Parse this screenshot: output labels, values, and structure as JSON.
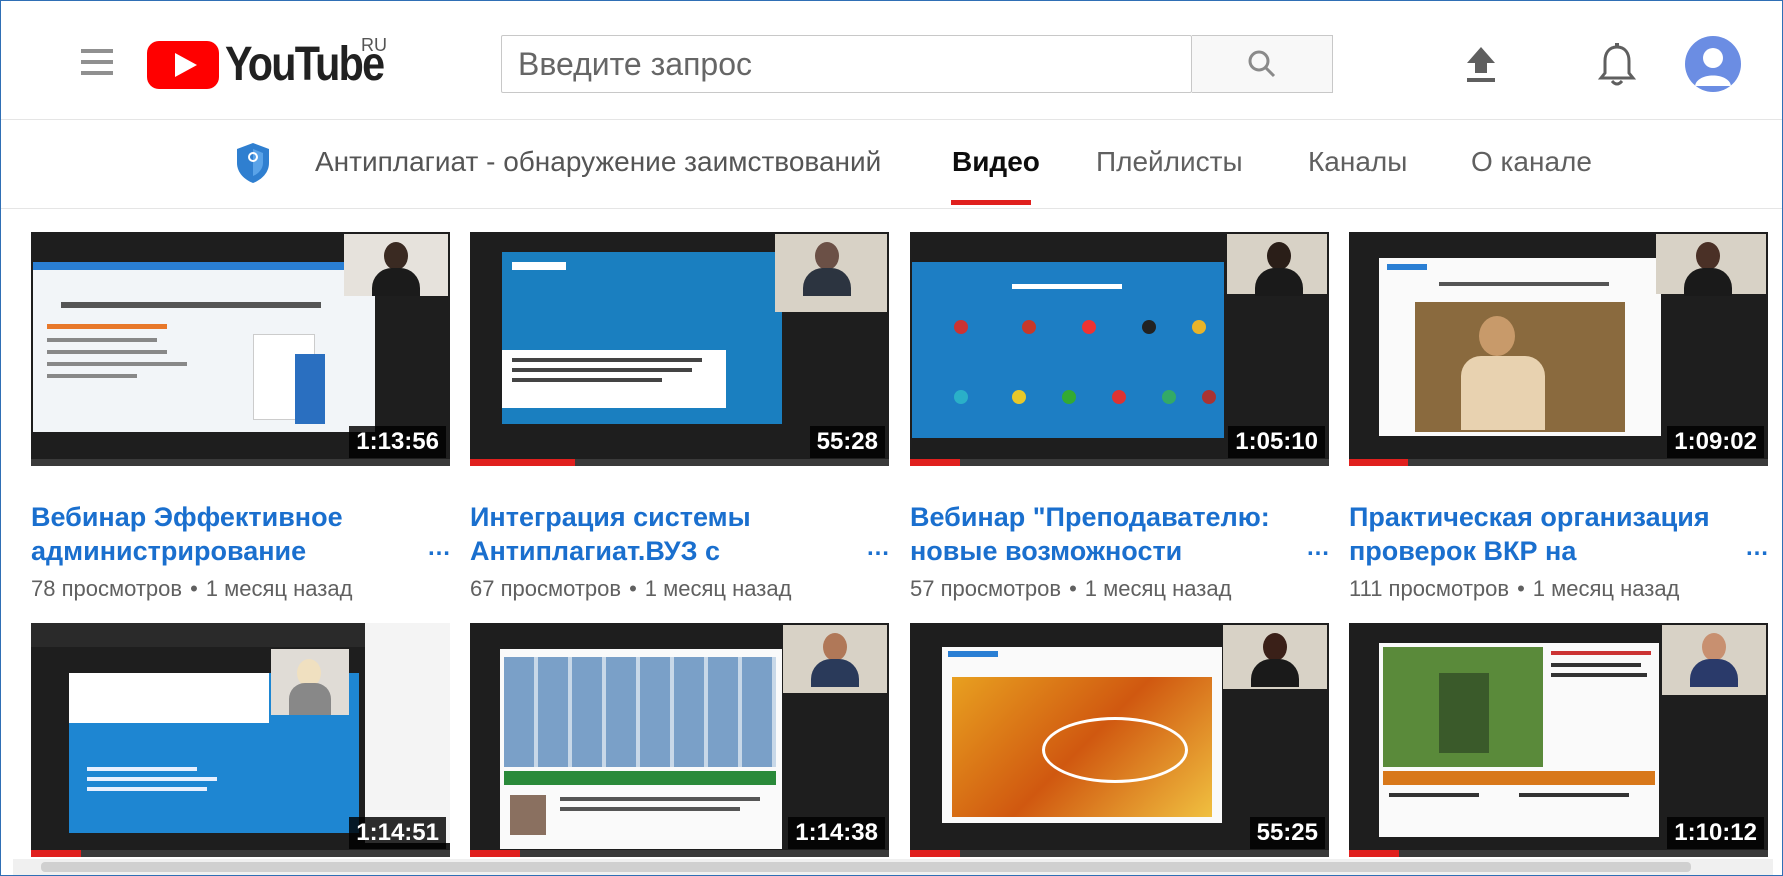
{
  "header": {
    "logo_text": "YouTube",
    "region": "RU",
    "search_placeholder": "Введите запрос"
  },
  "channel": {
    "name": "Антиплагиат - обнаружение заимствований",
    "tabs": [
      {
        "label": "Видео",
        "active": true
      },
      {
        "label": "Плейлисты",
        "active": false
      },
      {
        "label": "Каналы",
        "active": false
      },
      {
        "label": "О канале",
        "active": false
      }
    ]
  },
  "videos": [
    {
      "title": "Вебинар Эффективное администрирование",
      "views": "78 просмотров",
      "age": "1 месяц назад",
      "duration": "1:13:56",
      "watched": 0.0
    },
    {
      "title": "Интеграция системы Антиплагиат.ВУЗ с",
      "views": "67 просмотров",
      "age": "1 месяц назад",
      "duration": "55:28",
      "watched": 0.25
    },
    {
      "title": "Вебинар \"Преподавателю: новые возможности",
      "views": "57 просмотров",
      "age": "1 месяц назад",
      "duration": "1:05:10",
      "watched": 0.12
    },
    {
      "title": "Практическая организация проверок ВКР на",
      "views": "111 просмотров",
      "age": "1 месяц назад",
      "duration": "1:09:02",
      "watched": 0.14
    },
    {
      "title": "",
      "views": "",
      "age": "",
      "duration": "1:14:51",
      "watched": 0.12
    },
    {
      "title": "",
      "views": "",
      "age": "",
      "duration": "1:14:38",
      "watched": 0.12
    },
    {
      "title": "",
      "views": "",
      "age": "",
      "duration": "55:25",
      "watched": 0.12
    },
    {
      "title": "",
      "views": "",
      "age": "",
      "duration": "1:10:12",
      "watched": 0.12
    }
  ],
  "colors": {
    "brand_red": "#ff0000",
    "link_blue": "#1a6fce",
    "tab_underline": "#e0201e"
  }
}
